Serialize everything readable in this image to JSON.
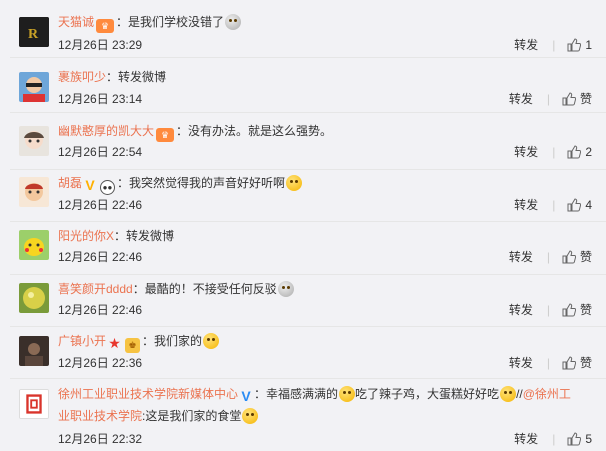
{
  "comments": [
    {
      "username": "天猫诚",
      "badges": [
        "vip-crown-icon"
      ],
      "content": "是我们学校没错了",
      "emoji": "crying-face-emoji",
      "time": "12月26日 23:29",
      "repost_label": "转发",
      "like_label": "1"
    },
    {
      "username": "裹族叩少",
      "badges": [],
      "content": "转发微博",
      "emoji": "",
      "time": "12月26日 23:14",
      "repost_label": "转发",
      "like_label": "赞"
    },
    {
      "username": "幽默憨厚的凯大大",
      "badges": [
        "vip-crown-icon"
      ],
      "content": "没有办法。就是这么强势。",
      "emoji": "",
      "time": "12月26日 22:54",
      "repost_label": "转发",
      "like_label": "2"
    },
    {
      "username": "胡磊",
      "badges": [
        "verified-v-icon",
        "panda-icon"
      ],
      "content": "我突然觉得我的声音好好听啊",
      "emoji": "grin-emoji",
      "time": "12月26日 22:46",
      "repost_label": "转发",
      "like_label": "4"
    },
    {
      "username": "阳光的你X",
      "badges": [],
      "content": "转发微博",
      "emoji": "",
      "time": "12月26日 22:46",
      "repost_label": "转发",
      "like_label": "赞"
    },
    {
      "username": "喜笑颜开dddd",
      "badges": [],
      "content": "最酷的！不接受任何反驳",
      "emoji": "crying-face-emoji",
      "time": "12月26日 22:46",
      "repost_label": "转发",
      "like_label": "赞"
    },
    {
      "username": "广镇小开",
      "badges": [
        "star-icon",
        "cup-icon"
      ],
      "content": "我们家的",
      "emoji": "smile-emoji",
      "time": "12月26日 22:36",
      "repost_label": "转发",
      "like_label": "赞"
    },
    {
      "username": "徐州工业职业技术学院新媒体中心",
      "badges": [
        "verified-blue-v-icon"
      ],
      "content_a": "幸福感满满的",
      "content_b": "吃了辣子鸡，大蛋糕好好吃",
      "content_c": "//",
      "mention_line1": "@徐州工",
      "mention_line2": "业职业技术学院",
      "content_d": ":这是我们家的食堂",
      "time": "12月26日 22:32",
      "repost_label": "转发",
      "like_label": "5"
    }
  ],
  "colors": {
    "username": "#eb7350",
    "background": "#f2f2f5",
    "text": "#333333"
  }
}
